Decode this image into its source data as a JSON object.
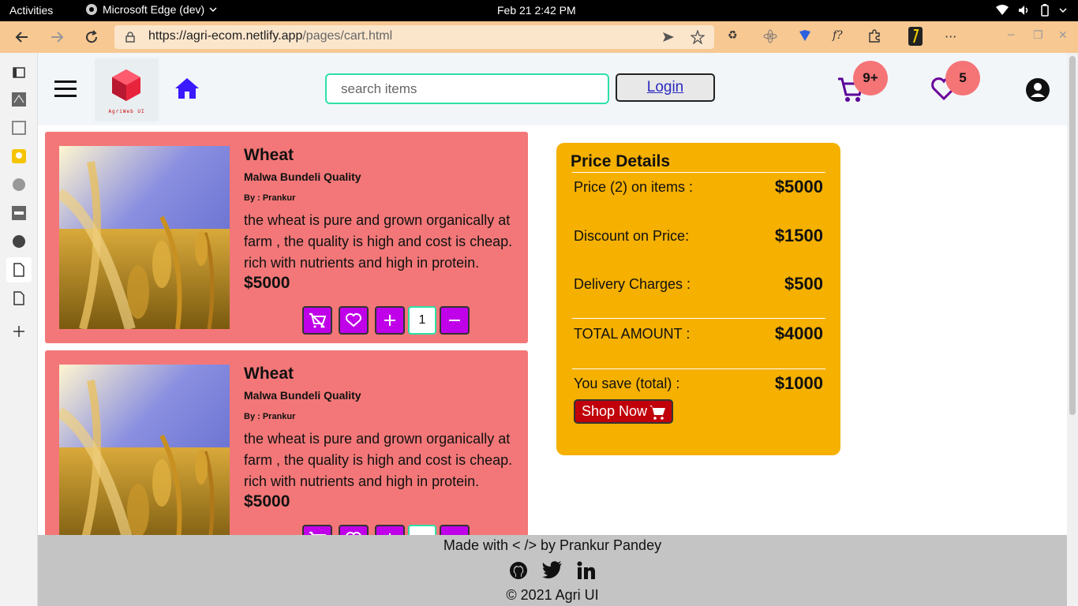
{
  "system": {
    "activities": "Activities",
    "app_name": "Microsoft Edge (dev)",
    "clock": "Feb 21  2:42 PM"
  },
  "browser": {
    "url_host": "https://agri-ecom.netlify.app",
    "url_path": "/pages/cart.html"
  },
  "nav": {
    "logo_text": "AgriWeb UI",
    "search_placeholder": "search items",
    "login_label": "Login",
    "cart_count": "9+",
    "wishlist_count": "5"
  },
  "products": [
    {
      "title": "Wheat",
      "quality": "Malwa Bundeli Quality",
      "by": "By : Prankur",
      "description": "the wheat is pure and grown organically at farm , the quality is high and cost is cheap. rich with nutrients and high in protein.",
      "price": "$5000",
      "qty": "1"
    },
    {
      "title": "Wheat",
      "quality": "Malwa Bundeli Quality",
      "by": "By : Prankur",
      "description": "the wheat is pure and grown organically at farm , the quality is high and cost is cheap. rich with nutrients and high in protein.",
      "price": "$5000",
      "qty": ""
    }
  ],
  "price_details": {
    "title": "Price Details",
    "rows": [
      {
        "label": "Price (2) on items :",
        "value": "$5000"
      },
      {
        "label": "Discount on Price:",
        "value": "$1500"
      },
      {
        "label": "Delivery Charges :",
        "value": "$500"
      },
      {
        "label": "TOTAL AMOUNT :",
        "value": "$4000"
      },
      {
        "label": "You save (total) :",
        "value": "$1000"
      }
    ],
    "shop_label": "Shop Now"
  },
  "footer": {
    "made_with": "Made with < /> by Prankur Pandey",
    "copyright": "© 2021 Agri UI"
  },
  "colors": {
    "accent_purple": "#c000e8",
    "card_bg": "#f37778",
    "price_panel": "#f5b000",
    "shop_button": "#c0000a",
    "badge": "#f57476"
  }
}
